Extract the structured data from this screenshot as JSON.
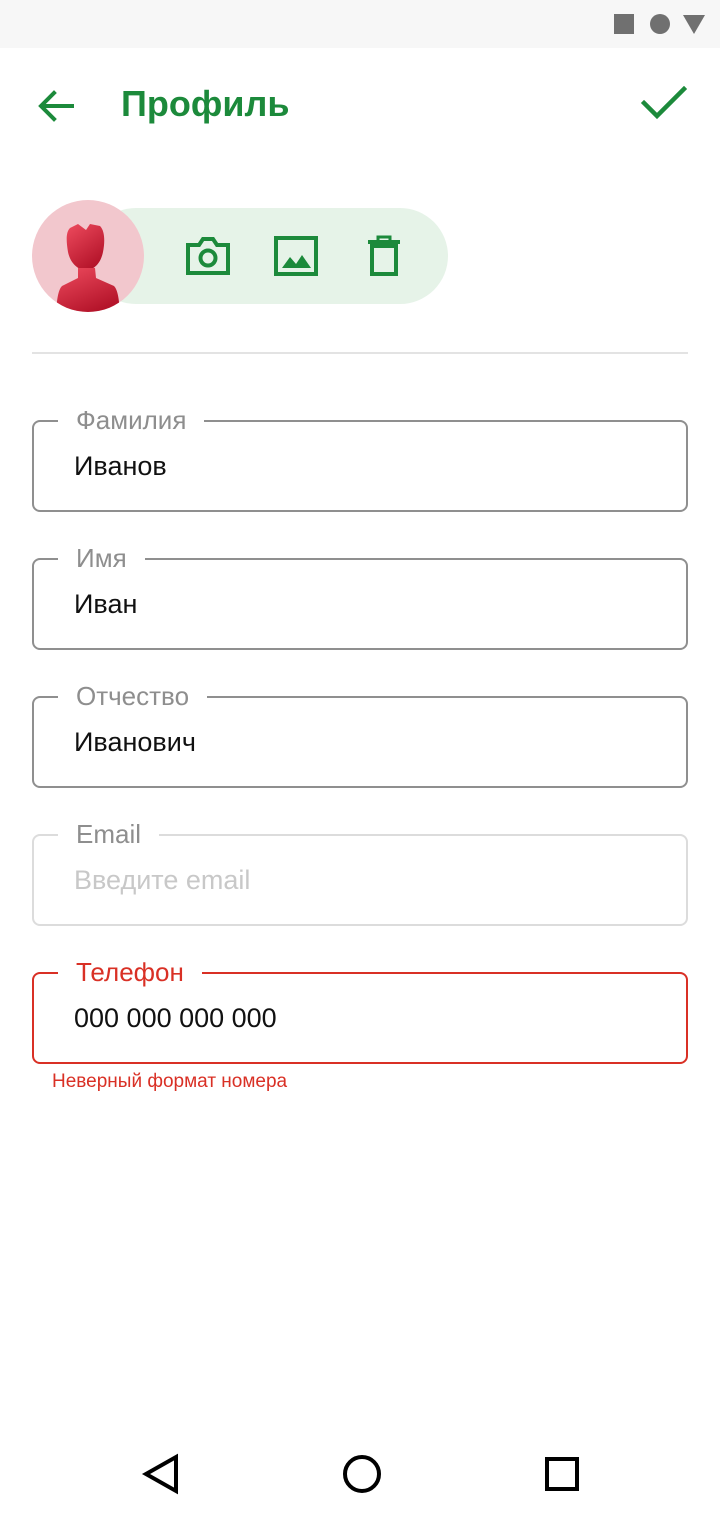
{
  "status_bar": {
    "icons": [
      "stop-square-icon",
      "record-circle-icon",
      "signal-triangle-icon"
    ],
    "icon_color": "#707070"
  },
  "app_bar": {
    "title": "Профиль",
    "back_icon": "arrow-left-icon",
    "save_icon": "check-icon",
    "accent_color": "#1c8a3b"
  },
  "photo_actions": {
    "avatar_icon": "user-avatar-icon",
    "actions": [
      "camera-icon",
      "image-icon",
      "trash-icon"
    ],
    "pill_color": "#e6f3e8"
  },
  "form": {
    "last_name": {
      "label": "Фамилия",
      "value": "Иванов"
    },
    "first_name": {
      "label": "Имя",
      "value": "Иван"
    },
    "middle_name": {
      "label": "Отчество",
      "value": "Иванович"
    },
    "email": {
      "label": "Email",
      "value": "",
      "placeholder": "Введите email"
    },
    "phone": {
      "label": "Телефон",
      "value": "000 000 000 000",
      "error": "Неверный формат номера"
    },
    "error_color": "#d93025"
  },
  "nav_bar": {
    "icons": [
      "nav-back-triangle-icon",
      "nav-home-circle-icon",
      "nav-recents-square-icon"
    ]
  }
}
